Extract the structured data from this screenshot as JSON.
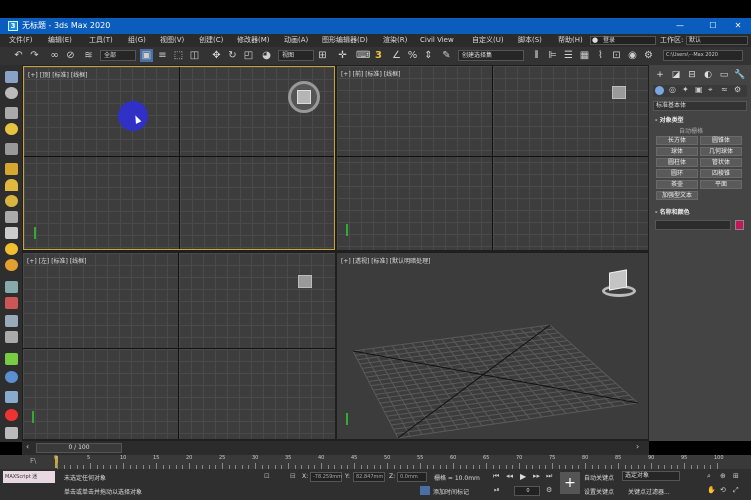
{
  "titlebar": {
    "title": "无标题 - 3ds Max 2020",
    "logo": "3"
  },
  "menu": [
    "文件(F)",
    "编辑(E)",
    "工具(T)",
    "组(G)",
    "视图(V)",
    "创建(C)",
    "修改器(M)",
    "动画(A)",
    "图形编辑器(D)",
    "渲染(R)",
    "Civil View",
    "自定义(U)",
    "脚本(S)",
    "帮助(H)"
  ],
  "menu_right": {
    "login": "登录",
    "workspace_label": "工作区:",
    "workspace_value": "默认"
  },
  "toolbar": {
    "filter": "全部",
    "view": "视图",
    "selection_set": "创建选择集",
    "path": "C:\\Users\\···Max 2020"
  },
  "viewports": {
    "top": "[+] [顶] [标准] [线框]",
    "front": "[+] [前] [标准] [线框]",
    "left": "[+] [左] [标准] [线框]",
    "perspective": "[+] [透视] [标准] [默认明暗处理]"
  },
  "command_panel": {
    "dropdown": "标准基本体",
    "section_object_type": "- 对象类型",
    "autogrid": "自动栅格",
    "objects": [
      "长方体",
      "圆锥体",
      "球体",
      "几何球体",
      "圆柱体",
      "管状体",
      "圆环",
      "四棱锥",
      "茶壶",
      "平面",
      "加强型文本"
    ],
    "section_name_color": "- 名称和颜色",
    "color": "#c2185b"
  },
  "timeline": {
    "frame": "0 / 100"
  },
  "track_ticks": [
    "0",
    "5",
    "10",
    "15",
    "20",
    "25",
    "30",
    "35",
    "40",
    "45",
    "50",
    "55",
    "60",
    "65",
    "70",
    "75",
    "80",
    "85",
    "90",
    "95",
    "100"
  ],
  "status": {
    "maxscript": "MAXScript 迷",
    "line1": "未选定任何对象",
    "line2": "单击或单击并拖动以选择对象",
    "x_label": "X:",
    "x_value": "-78.259mm",
    "y_label": "Y:",
    "y_value": "82.847mm",
    "z_label": "Z:",
    "z_value": "0.0mm",
    "grid": "栅格 = 10.0mm",
    "add_time_tag": "添加时间标记",
    "autokey": "自动关键点",
    "selected_obj": "选定对象",
    "setkey": "设置关键点",
    "key_filters": "关键点过滤器...",
    "frame_value": "0"
  },
  "colors": {
    "title_bg": "#0b5dbd",
    "viewport_bg": "#3d3d3d",
    "active_border": "#c8a43a",
    "cursor_highlight": "#3030d0"
  }
}
